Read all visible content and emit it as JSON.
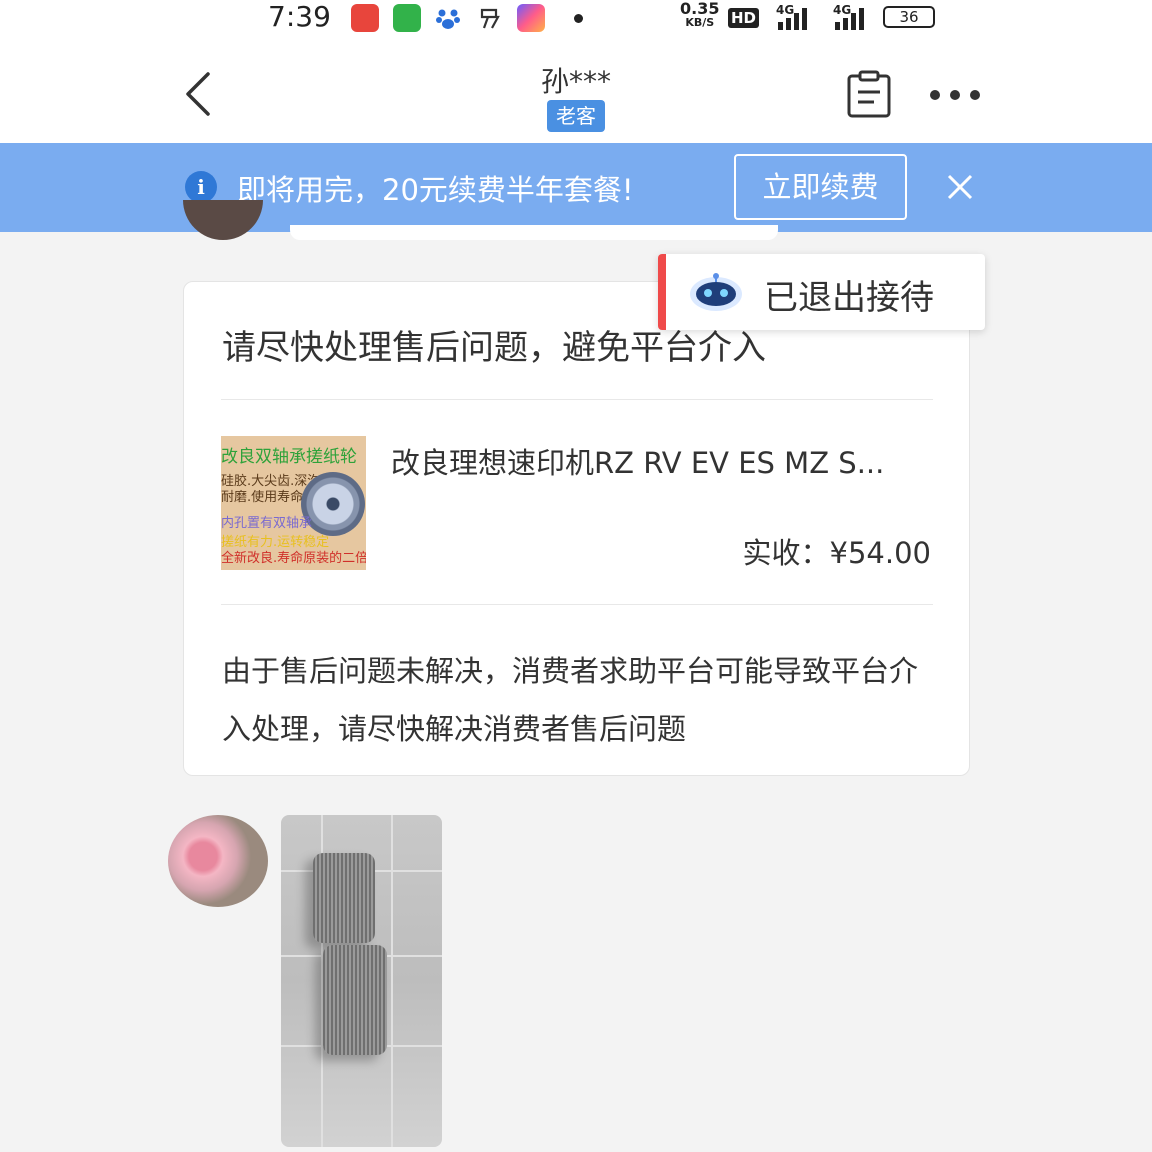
{
  "status_bar": {
    "time": "7:39",
    "speed_value": "0.35",
    "speed_unit": "KB/S",
    "hd": "HD",
    "network_1": "4G",
    "network_2": "4G",
    "battery": "36",
    "app_icons": [
      "shop-app-icon",
      "wechat-app-icon",
      "baidu-app-icon",
      "yi-app-icon",
      "browser-app-icon"
    ]
  },
  "header": {
    "title": "孙***",
    "tag": "老客"
  },
  "banner": {
    "message": "即将用完，20元续费半年套餐!",
    "button_label": "立即续费"
  },
  "card": {
    "title": "请尽快处理售后问题，避免平台介入",
    "product": {
      "thumb_lines": [
        "改良双轴承搓纸轮",
        "硅胶.大尖齿.深沟",
        "耐磨.使用寿命长",
        "内孔置有双轴承",
        "搓纸有力.运转稳定",
        "全新改良.寿命原装的二倍"
      ],
      "name": "改良理想速印机RZ RV EV ES MZ S...",
      "price": "实收：¥54.00"
    },
    "description": "由于售后问题未解决，消费者求助平台可能导致平台介入处理，请尽快解决消费者售后问题"
  },
  "toast": {
    "text": "已退出接待"
  },
  "colors": {
    "banner_bg": "#7aacf0",
    "tag_bg": "#4a90e2",
    "toast_accent": "#ef4a4a"
  }
}
